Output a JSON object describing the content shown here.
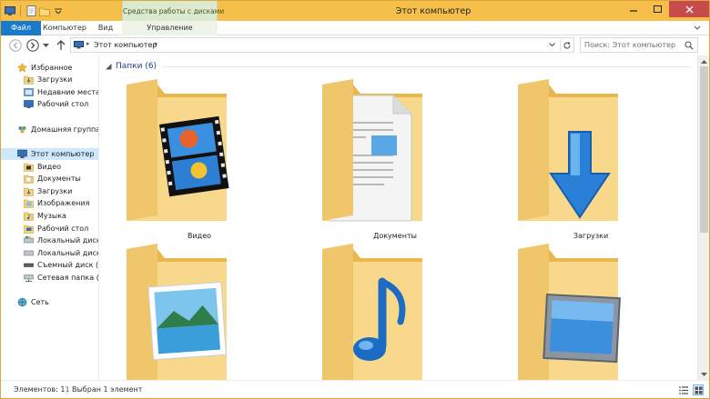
{
  "window": {
    "title": "Этот компьютер",
    "contextual_group": "Средства работы с дисками"
  },
  "ribbon": {
    "tabs": [
      {
        "id": "file",
        "label": "Файл"
      },
      {
        "id": "computer",
        "label": "Компьютер"
      },
      {
        "id": "view",
        "label": "Вид"
      },
      {
        "id": "manage",
        "label": "Управление"
      }
    ],
    "help": "?"
  },
  "address": {
    "path": "Этот компьютер",
    "search_placeholder": "Поиск: Этот компьютер"
  },
  "sidebar": {
    "items": [
      {
        "label": "Избранное",
        "icon": "star-icon"
      },
      {
        "label": "Загрузки",
        "icon": "downloads-folder-icon"
      },
      {
        "label": "Недавние места",
        "icon": "recent-places-icon"
      },
      {
        "label": "Рабочий стол",
        "icon": "desktop-icon"
      },
      {
        "label": "Домашняя группа",
        "icon": "homegroup-icon"
      },
      {
        "label": "Этот компьютер",
        "icon": "computer-icon"
      },
      {
        "label": "Видео",
        "icon": "video-folder-icon"
      },
      {
        "label": "Документы",
        "icon": "documents-folder-icon"
      },
      {
        "label": "Загрузки",
        "icon": "downloads-folder-icon"
      },
      {
        "label": "Изображения",
        "icon": "pictures-folder-icon"
      },
      {
        "label": "Музыка",
        "icon": "music-folder-icon"
      },
      {
        "label": "Рабочий стол",
        "icon": "desktop-folder-icon"
      },
      {
        "label": "Локальный диск (С",
        "icon": "drive-icon"
      },
      {
        "label": "Локальный диск (D",
        "icon": "drive-icon"
      },
      {
        "label": "Съемный диск (F:)",
        "icon": "removable-drive-icon"
      },
      {
        "label": "Сетевая папка (Z:)",
        "icon": "network-drive-icon"
      },
      {
        "label": "Сеть",
        "icon": "network-icon"
      }
    ]
  },
  "content": {
    "group_title": "Папки (6)",
    "folders": [
      {
        "label": "Видео",
        "icon": "video-folder-icon"
      },
      {
        "label": "Документы",
        "icon": "documents-folder-icon"
      },
      {
        "label": "Загрузки",
        "icon": "downloads-folder-icon"
      },
      {
        "label": "",
        "icon": "pictures-folder-icon"
      },
      {
        "label": "",
        "icon": "music-folder-icon"
      },
      {
        "label": "",
        "icon": "desktop-folder-icon"
      }
    ]
  },
  "status": {
    "count": "Элементов: 11",
    "selected": "Выбран 1 элемент"
  },
  "colors": {
    "titlebar": "#f6bf4a",
    "file_tab": "#1979ca",
    "contextual_group": "#dce8cf",
    "selection": "#cde8ff",
    "group_header_text": "#1e3c96"
  }
}
